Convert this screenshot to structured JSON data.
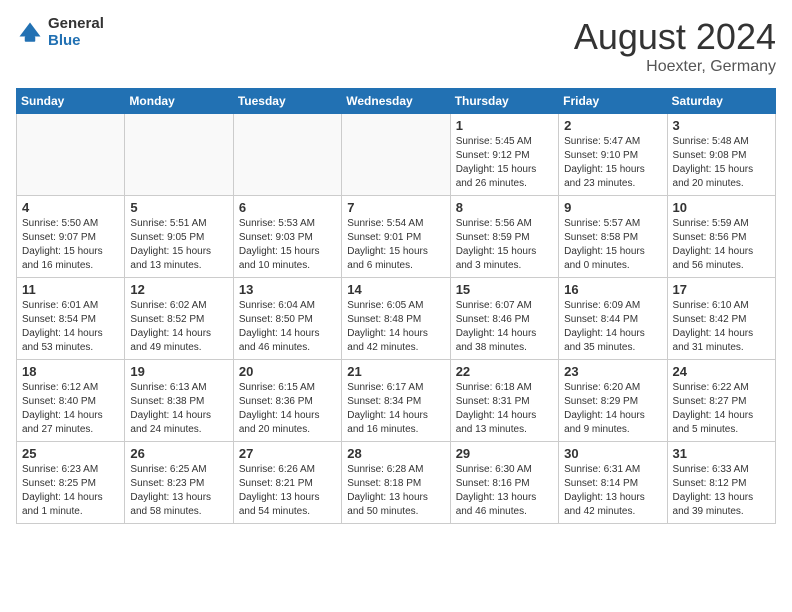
{
  "logo": {
    "general": "General",
    "blue": "Blue"
  },
  "header": {
    "month": "August 2024",
    "location": "Hoexter, Germany"
  },
  "weekdays": [
    "Sunday",
    "Monday",
    "Tuesday",
    "Wednesday",
    "Thursday",
    "Friday",
    "Saturday"
  ],
  "weeks": [
    [
      {
        "day": "",
        "sunrise": "",
        "sunset": "",
        "daylight": ""
      },
      {
        "day": "",
        "sunrise": "",
        "sunset": "",
        "daylight": ""
      },
      {
        "day": "",
        "sunrise": "",
        "sunset": "",
        "daylight": ""
      },
      {
        "day": "",
        "sunrise": "",
        "sunset": "",
        "daylight": ""
      },
      {
        "day": "1",
        "sunrise": "Sunrise: 5:45 AM",
        "sunset": "Sunset: 9:12 PM",
        "daylight": "Daylight: 15 hours and 26 minutes."
      },
      {
        "day": "2",
        "sunrise": "Sunrise: 5:47 AM",
        "sunset": "Sunset: 9:10 PM",
        "daylight": "Daylight: 15 hours and 23 minutes."
      },
      {
        "day": "3",
        "sunrise": "Sunrise: 5:48 AM",
        "sunset": "Sunset: 9:08 PM",
        "daylight": "Daylight: 15 hours and 20 minutes."
      }
    ],
    [
      {
        "day": "4",
        "sunrise": "Sunrise: 5:50 AM",
        "sunset": "Sunset: 9:07 PM",
        "daylight": "Daylight: 15 hours and 16 minutes."
      },
      {
        "day": "5",
        "sunrise": "Sunrise: 5:51 AM",
        "sunset": "Sunset: 9:05 PM",
        "daylight": "Daylight: 15 hours and 13 minutes."
      },
      {
        "day": "6",
        "sunrise": "Sunrise: 5:53 AM",
        "sunset": "Sunset: 9:03 PM",
        "daylight": "Daylight: 15 hours and 10 minutes."
      },
      {
        "day": "7",
        "sunrise": "Sunrise: 5:54 AM",
        "sunset": "Sunset: 9:01 PM",
        "daylight": "Daylight: 15 hours and 6 minutes."
      },
      {
        "day": "8",
        "sunrise": "Sunrise: 5:56 AM",
        "sunset": "Sunset: 8:59 PM",
        "daylight": "Daylight: 15 hours and 3 minutes."
      },
      {
        "day": "9",
        "sunrise": "Sunrise: 5:57 AM",
        "sunset": "Sunset: 8:58 PM",
        "daylight": "Daylight: 15 hours and 0 minutes."
      },
      {
        "day": "10",
        "sunrise": "Sunrise: 5:59 AM",
        "sunset": "Sunset: 8:56 PM",
        "daylight": "Daylight: 14 hours and 56 minutes."
      }
    ],
    [
      {
        "day": "11",
        "sunrise": "Sunrise: 6:01 AM",
        "sunset": "Sunset: 8:54 PM",
        "daylight": "Daylight: 14 hours and 53 minutes."
      },
      {
        "day": "12",
        "sunrise": "Sunrise: 6:02 AM",
        "sunset": "Sunset: 8:52 PM",
        "daylight": "Daylight: 14 hours and 49 minutes."
      },
      {
        "day": "13",
        "sunrise": "Sunrise: 6:04 AM",
        "sunset": "Sunset: 8:50 PM",
        "daylight": "Daylight: 14 hours and 46 minutes."
      },
      {
        "day": "14",
        "sunrise": "Sunrise: 6:05 AM",
        "sunset": "Sunset: 8:48 PM",
        "daylight": "Daylight: 14 hours and 42 minutes."
      },
      {
        "day": "15",
        "sunrise": "Sunrise: 6:07 AM",
        "sunset": "Sunset: 8:46 PM",
        "daylight": "Daylight: 14 hours and 38 minutes."
      },
      {
        "day": "16",
        "sunrise": "Sunrise: 6:09 AM",
        "sunset": "Sunset: 8:44 PM",
        "daylight": "Daylight: 14 hours and 35 minutes."
      },
      {
        "day": "17",
        "sunrise": "Sunrise: 6:10 AM",
        "sunset": "Sunset: 8:42 PM",
        "daylight": "Daylight: 14 hours and 31 minutes."
      }
    ],
    [
      {
        "day": "18",
        "sunrise": "Sunrise: 6:12 AM",
        "sunset": "Sunset: 8:40 PM",
        "daylight": "Daylight: 14 hours and 27 minutes."
      },
      {
        "day": "19",
        "sunrise": "Sunrise: 6:13 AM",
        "sunset": "Sunset: 8:38 PM",
        "daylight": "Daylight: 14 hours and 24 minutes."
      },
      {
        "day": "20",
        "sunrise": "Sunrise: 6:15 AM",
        "sunset": "Sunset: 8:36 PM",
        "daylight": "Daylight: 14 hours and 20 minutes."
      },
      {
        "day": "21",
        "sunrise": "Sunrise: 6:17 AM",
        "sunset": "Sunset: 8:34 PM",
        "daylight": "Daylight: 14 hours and 16 minutes."
      },
      {
        "day": "22",
        "sunrise": "Sunrise: 6:18 AM",
        "sunset": "Sunset: 8:31 PM",
        "daylight": "Daylight: 14 hours and 13 minutes."
      },
      {
        "day": "23",
        "sunrise": "Sunrise: 6:20 AM",
        "sunset": "Sunset: 8:29 PM",
        "daylight": "Daylight: 14 hours and 9 minutes."
      },
      {
        "day": "24",
        "sunrise": "Sunrise: 6:22 AM",
        "sunset": "Sunset: 8:27 PM",
        "daylight": "Daylight: 14 hours and 5 minutes."
      }
    ],
    [
      {
        "day": "25",
        "sunrise": "Sunrise: 6:23 AM",
        "sunset": "Sunset: 8:25 PM",
        "daylight": "Daylight: 14 hours and 1 minute."
      },
      {
        "day": "26",
        "sunrise": "Sunrise: 6:25 AM",
        "sunset": "Sunset: 8:23 PM",
        "daylight": "Daylight: 13 hours and 58 minutes."
      },
      {
        "day": "27",
        "sunrise": "Sunrise: 6:26 AM",
        "sunset": "Sunset: 8:21 PM",
        "daylight": "Daylight: 13 hours and 54 minutes."
      },
      {
        "day": "28",
        "sunrise": "Sunrise: 6:28 AM",
        "sunset": "Sunset: 8:18 PM",
        "daylight": "Daylight: 13 hours and 50 minutes."
      },
      {
        "day": "29",
        "sunrise": "Sunrise: 6:30 AM",
        "sunset": "Sunset: 8:16 PM",
        "daylight": "Daylight: 13 hours and 46 minutes."
      },
      {
        "day": "30",
        "sunrise": "Sunrise: 6:31 AM",
        "sunset": "Sunset: 8:14 PM",
        "daylight": "Daylight: 13 hours and 42 minutes."
      },
      {
        "day": "31",
        "sunrise": "Sunrise: 6:33 AM",
        "sunset": "Sunset: 8:12 PM",
        "daylight": "Daylight: 13 hours and 39 minutes."
      }
    ]
  ]
}
